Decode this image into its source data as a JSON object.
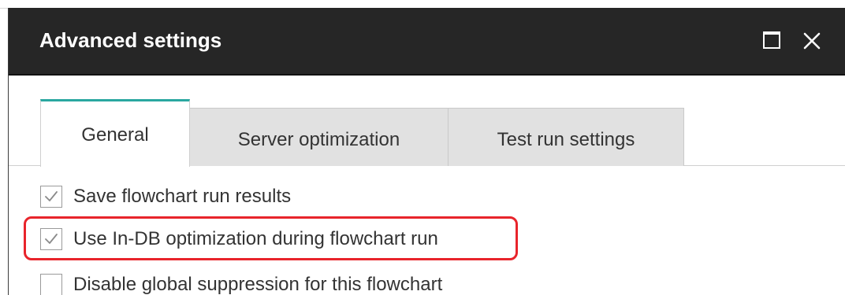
{
  "dialog": {
    "title": "Advanced settings",
    "controls": {
      "maximize_icon": "maximize-icon",
      "close_icon": "close-icon"
    }
  },
  "tabs": [
    {
      "label": "General",
      "active": true
    },
    {
      "label": "Server optimization",
      "active": false
    },
    {
      "label": "Test run settings",
      "active": false
    }
  ],
  "options": [
    {
      "label": "Save flowchart run results",
      "checked": true
    },
    {
      "label": "Use In-DB optimization during flowchart run",
      "checked": true,
      "highlighted": true
    },
    {
      "label": "Disable global suppression for this flowchart",
      "checked": false
    }
  ],
  "colors": {
    "titlebar": "#262626",
    "active_tab_accent": "#2aa7a0",
    "highlight": "#e8242b",
    "inactive_tab": "#e1e1e1"
  }
}
